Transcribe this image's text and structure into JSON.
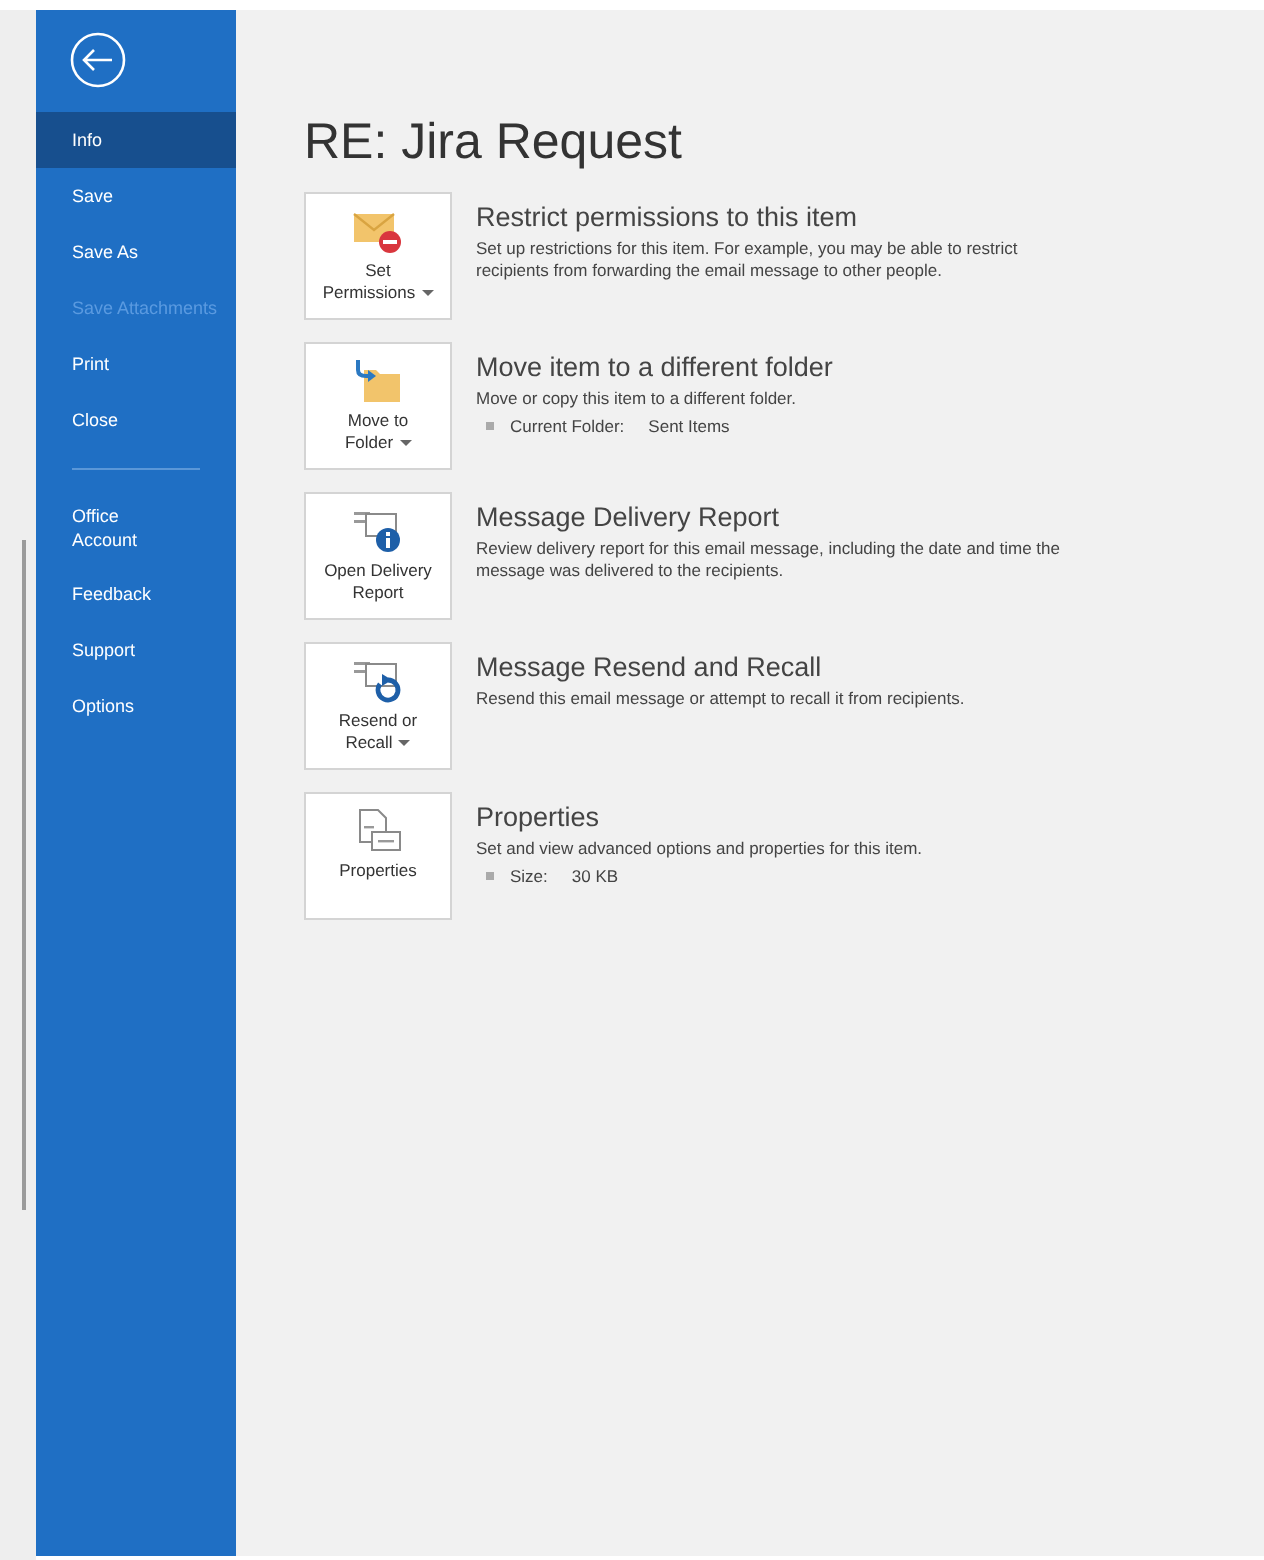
{
  "sidebar": {
    "groups": [
      [
        {
          "label": "Info",
          "selected": true,
          "disabled": false
        },
        {
          "label": "Save",
          "selected": false,
          "disabled": false
        },
        {
          "label": "Save As",
          "selected": false,
          "disabled": false
        },
        {
          "label": "Save Attachments",
          "selected": false,
          "disabled": true
        },
        {
          "label": "Print",
          "selected": false,
          "disabled": false
        },
        {
          "label": "Close",
          "selected": false,
          "disabled": false
        }
      ],
      [
        {
          "label": "Office\nAccount",
          "selected": false,
          "disabled": false
        },
        {
          "label": "Feedback",
          "selected": false,
          "disabled": false
        },
        {
          "label": "Support",
          "selected": false,
          "disabled": false
        },
        {
          "label": "Options",
          "selected": false,
          "disabled": false
        }
      ]
    ]
  },
  "title": "RE: Jira Request",
  "sections": [
    {
      "kind": "permissions",
      "button": "Set\nPermissions",
      "has_menu": true,
      "heading": "Restrict permissions to this item",
      "description": "Set up restrictions for this item. For example, you may be able to restrict recipients from forwarding the email message to other people."
    },
    {
      "kind": "move",
      "button": "Move to\nFolder",
      "has_menu": true,
      "heading": "Move item to a different folder",
      "description": "Move or copy this item to a different folder.",
      "details": [
        {
          "label": "Current Folder:",
          "value": "Sent Items"
        }
      ]
    },
    {
      "kind": "report",
      "button": "Open Delivery\nReport",
      "has_menu": false,
      "heading": "Message Delivery Report",
      "description": "Review delivery report for this email message, including the date and time the message was delivered to the recipients."
    },
    {
      "kind": "resend",
      "button": "Resend or\nRecall",
      "has_menu": true,
      "heading": "Message Resend and Recall",
      "description": "Resend this email message or attempt to recall it from recipients."
    },
    {
      "kind": "properties",
      "button": "Properties",
      "has_menu": false,
      "heading": "Properties",
      "description": "Set and view advanced options and properties for this item.",
      "details": [
        {
          "label": "Size:",
          "value": "30 KB"
        }
      ]
    }
  ]
}
